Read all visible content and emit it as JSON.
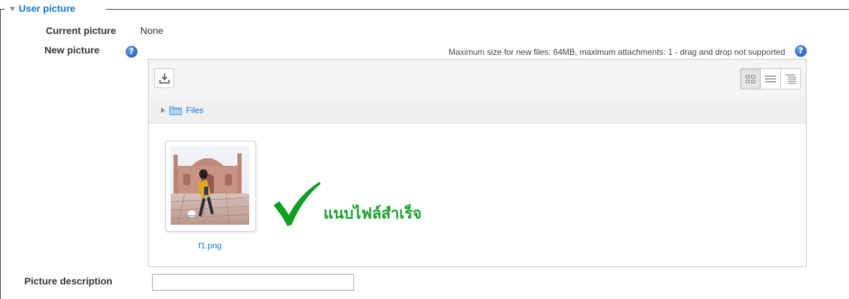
{
  "legend": {
    "title": "User picture"
  },
  "current_picture": {
    "label": "Current picture",
    "value": "None"
  },
  "new_picture": {
    "label": "New picture",
    "help_icon": "?"
  },
  "filemanager": {
    "limits_text": "Maximum size for new files: 64MB, maximum attachments: 1 - drag and drop not supported",
    "help_icon": "?",
    "add_button_icon": "download-icon",
    "view_buttons": [
      "icons-view-icon",
      "list-view-icon",
      "tree-view-icon"
    ],
    "active_view": "icons",
    "path": {
      "folder": "Files"
    },
    "files": [
      {
        "name": "f1.png"
      }
    ]
  },
  "overlay": {
    "message": "แนบไฟล์สำเร็จ",
    "check_color": "#0fa022"
  },
  "picture_description": {
    "label": "Picture description",
    "value": "",
    "placeholder": ""
  },
  "colors": {
    "link": "#1177d1",
    "success": "#17a02a"
  }
}
